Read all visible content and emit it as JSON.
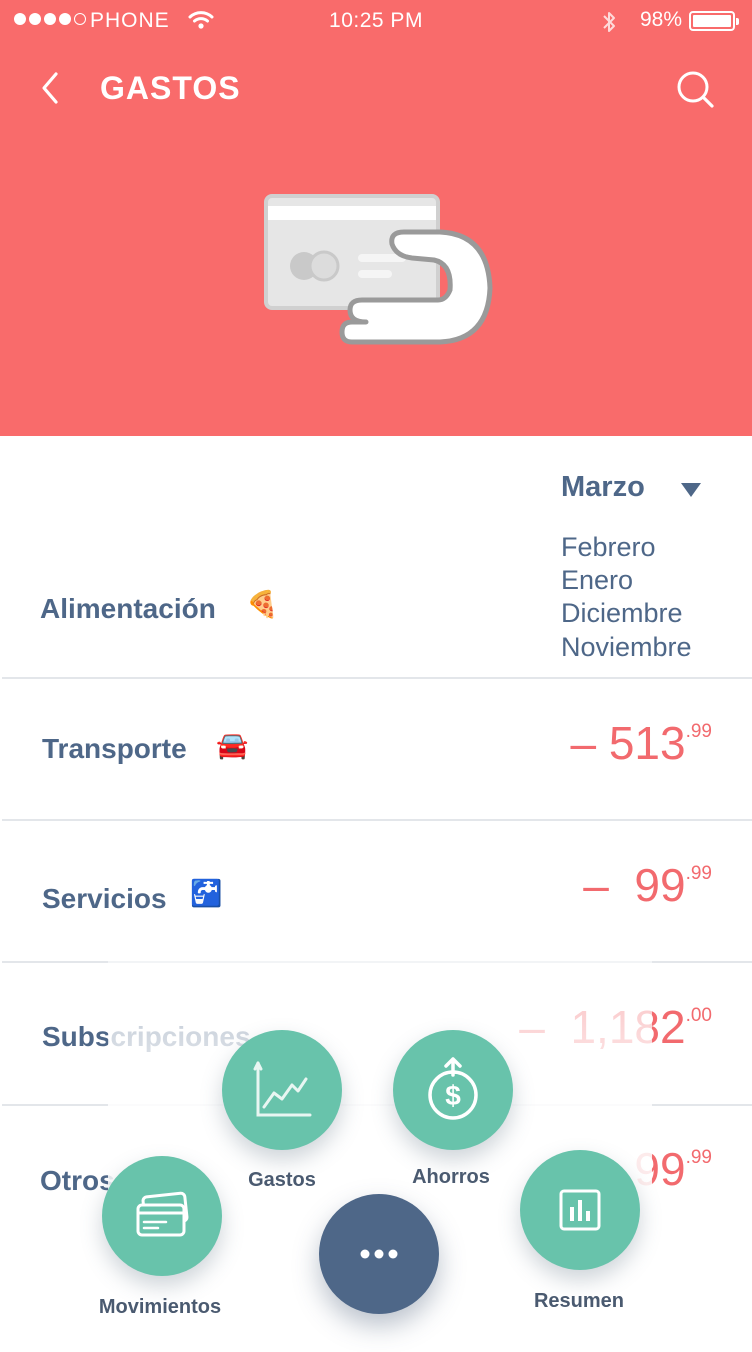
{
  "status_bar": {
    "carrier": "PHONE",
    "time": "10:25 PM",
    "battery_percent": "98%"
  },
  "header": {
    "title": "GASTOS",
    "back_icon": "chevron-left-icon",
    "search_icon": "search-icon",
    "background_color": "#F96B6B",
    "illustration": "credit-card-hand-illustration"
  },
  "month_selector": {
    "selected": "Marzo",
    "options": [
      "Febrero",
      "Enero",
      "Diciembre",
      "Noviembre"
    ]
  },
  "categories": [
    {
      "label": "Alimentación",
      "emoji": "🍕"
    },
    {
      "label": "Transporte",
      "emoji": "🚘",
      "sign": "–",
      "amount": "513",
      "cents": ".99"
    },
    {
      "label": "Servicios",
      "emoji": "🚰",
      "sign": "–",
      "amount": "99",
      "cents": ".99"
    },
    {
      "label": "Subscripciones",
      "sign": "–",
      "amount": "1,182",
      "cents": ".00"
    },
    {
      "label": "Otros",
      "amount": "99",
      "cents": ".99"
    }
  ],
  "fab_menu": {
    "gastos": "Gastos",
    "ahorros": "Ahorros",
    "movimientos": "Movimientos",
    "resumen": "Resumen",
    "main_icon": "more-dots-icon"
  },
  "colors": {
    "accent_red": "#F96B6B",
    "amount_red": "#F26A6E",
    "navy": "#4E6788",
    "teal": "#68C3AB"
  }
}
